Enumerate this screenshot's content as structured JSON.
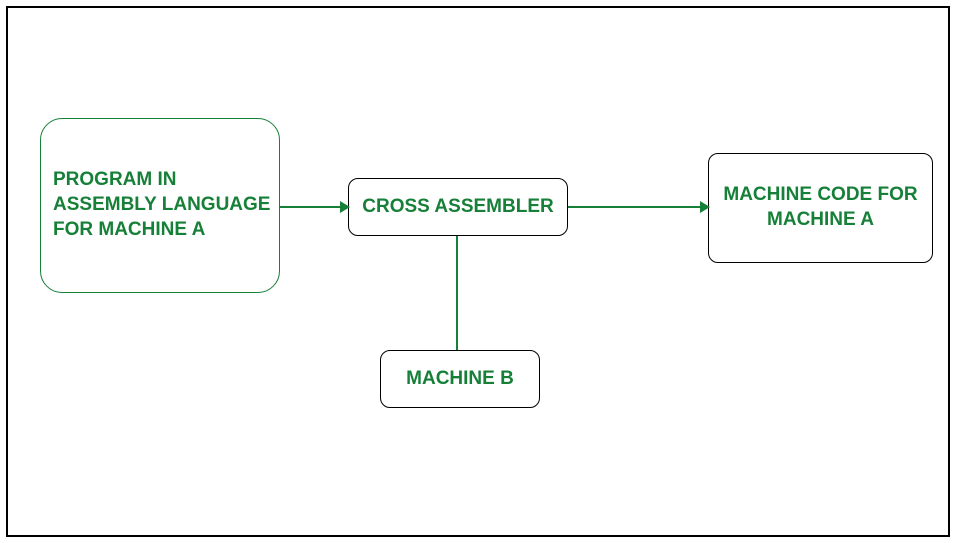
{
  "diagram": {
    "nodes": {
      "input": {
        "label": "PROGRAM IN ASSEMBLY LANGUAGE FOR MACHINE A"
      },
      "assembler": {
        "label": "CROSS ASSEMBLER"
      },
      "output": {
        "label": "MACHINE CODE FOR MACHINE A"
      },
      "machineb": {
        "label": "MACHINE B"
      }
    },
    "edges": [
      {
        "from": "input",
        "to": "assembler",
        "directed": true
      },
      {
        "from": "assembler",
        "to": "output",
        "directed": true
      },
      {
        "from": "assembler",
        "to": "machineb",
        "directed": false
      }
    ],
    "colors": {
      "text": "#178038",
      "greenBorder": "#178038",
      "blackBorder": "#000000"
    }
  }
}
